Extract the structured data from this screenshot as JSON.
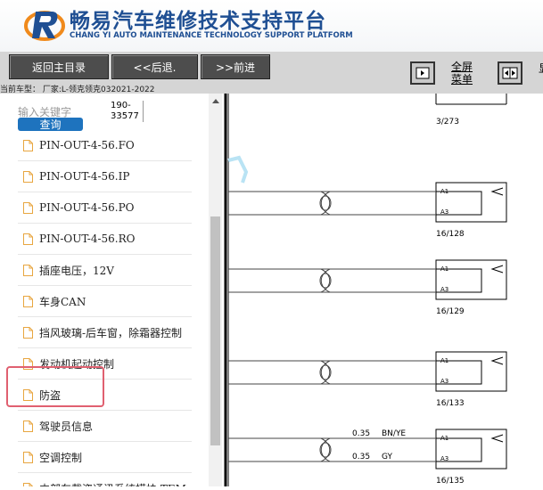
{
  "header": {
    "title": "畅易汽车维修技术支持平台",
    "subtitle": "CHANG YI AUTO MAINTENANCE TECHNOLOGY SUPPORT PLATFORM"
  },
  "toolbar": {
    "back_home": "返回主目录",
    "prev": "<<后退.",
    "next": ">>前进",
    "fullscreen_line1": "全屏",
    "fullscreen_line2": "菜单",
    "edge_char": "显"
  },
  "car_model": "当前车型：  厂家:L-领克领克032021-2022",
  "search": {
    "placeholder": "输入关键字",
    "button": "查询",
    "code_line1": "190-",
    "code_line2": "33577"
  },
  "list": {
    "items": [
      {
        "label": "PIN-OUT-4-56.FO"
      },
      {
        "label": "PIN-OUT-4-56.IP"
      },
      {
        "label": "PIN-OUT-4-56.PO"
      },
      {
        "label": "PIN-OUT-4-56.RO"
      },
      {
        "label": "插座电压，12V"
      },
      {
        "label": "车身CAN"
      },
      {
        "label": "挡风玻璃-后车窗，除霜器控制"
      },
      {
        "label": "发动机起动控制"
      },
      {
        "label": "防盗"
      },
      {
        "label": "驾驶员信息"
      },
      {
        "label": "空调控制"
      },
      {
        "label": "内部车载资通讯系统模块 TEM"
      }
    ]
  },
  "diagram": {
    "pin_a1": "A1",
    "pin_a3": "A3",
    "refs": [
      "3/273",
      "16/128",
      "16/129",
      "16/133",
      "16/135"
    ],
    "wire1_gauge": "0.35",
    "wire1_color": "BN/YE",
    "wire2_gauge": "0.35",
    "wire2_color": "GY"
  }
}
